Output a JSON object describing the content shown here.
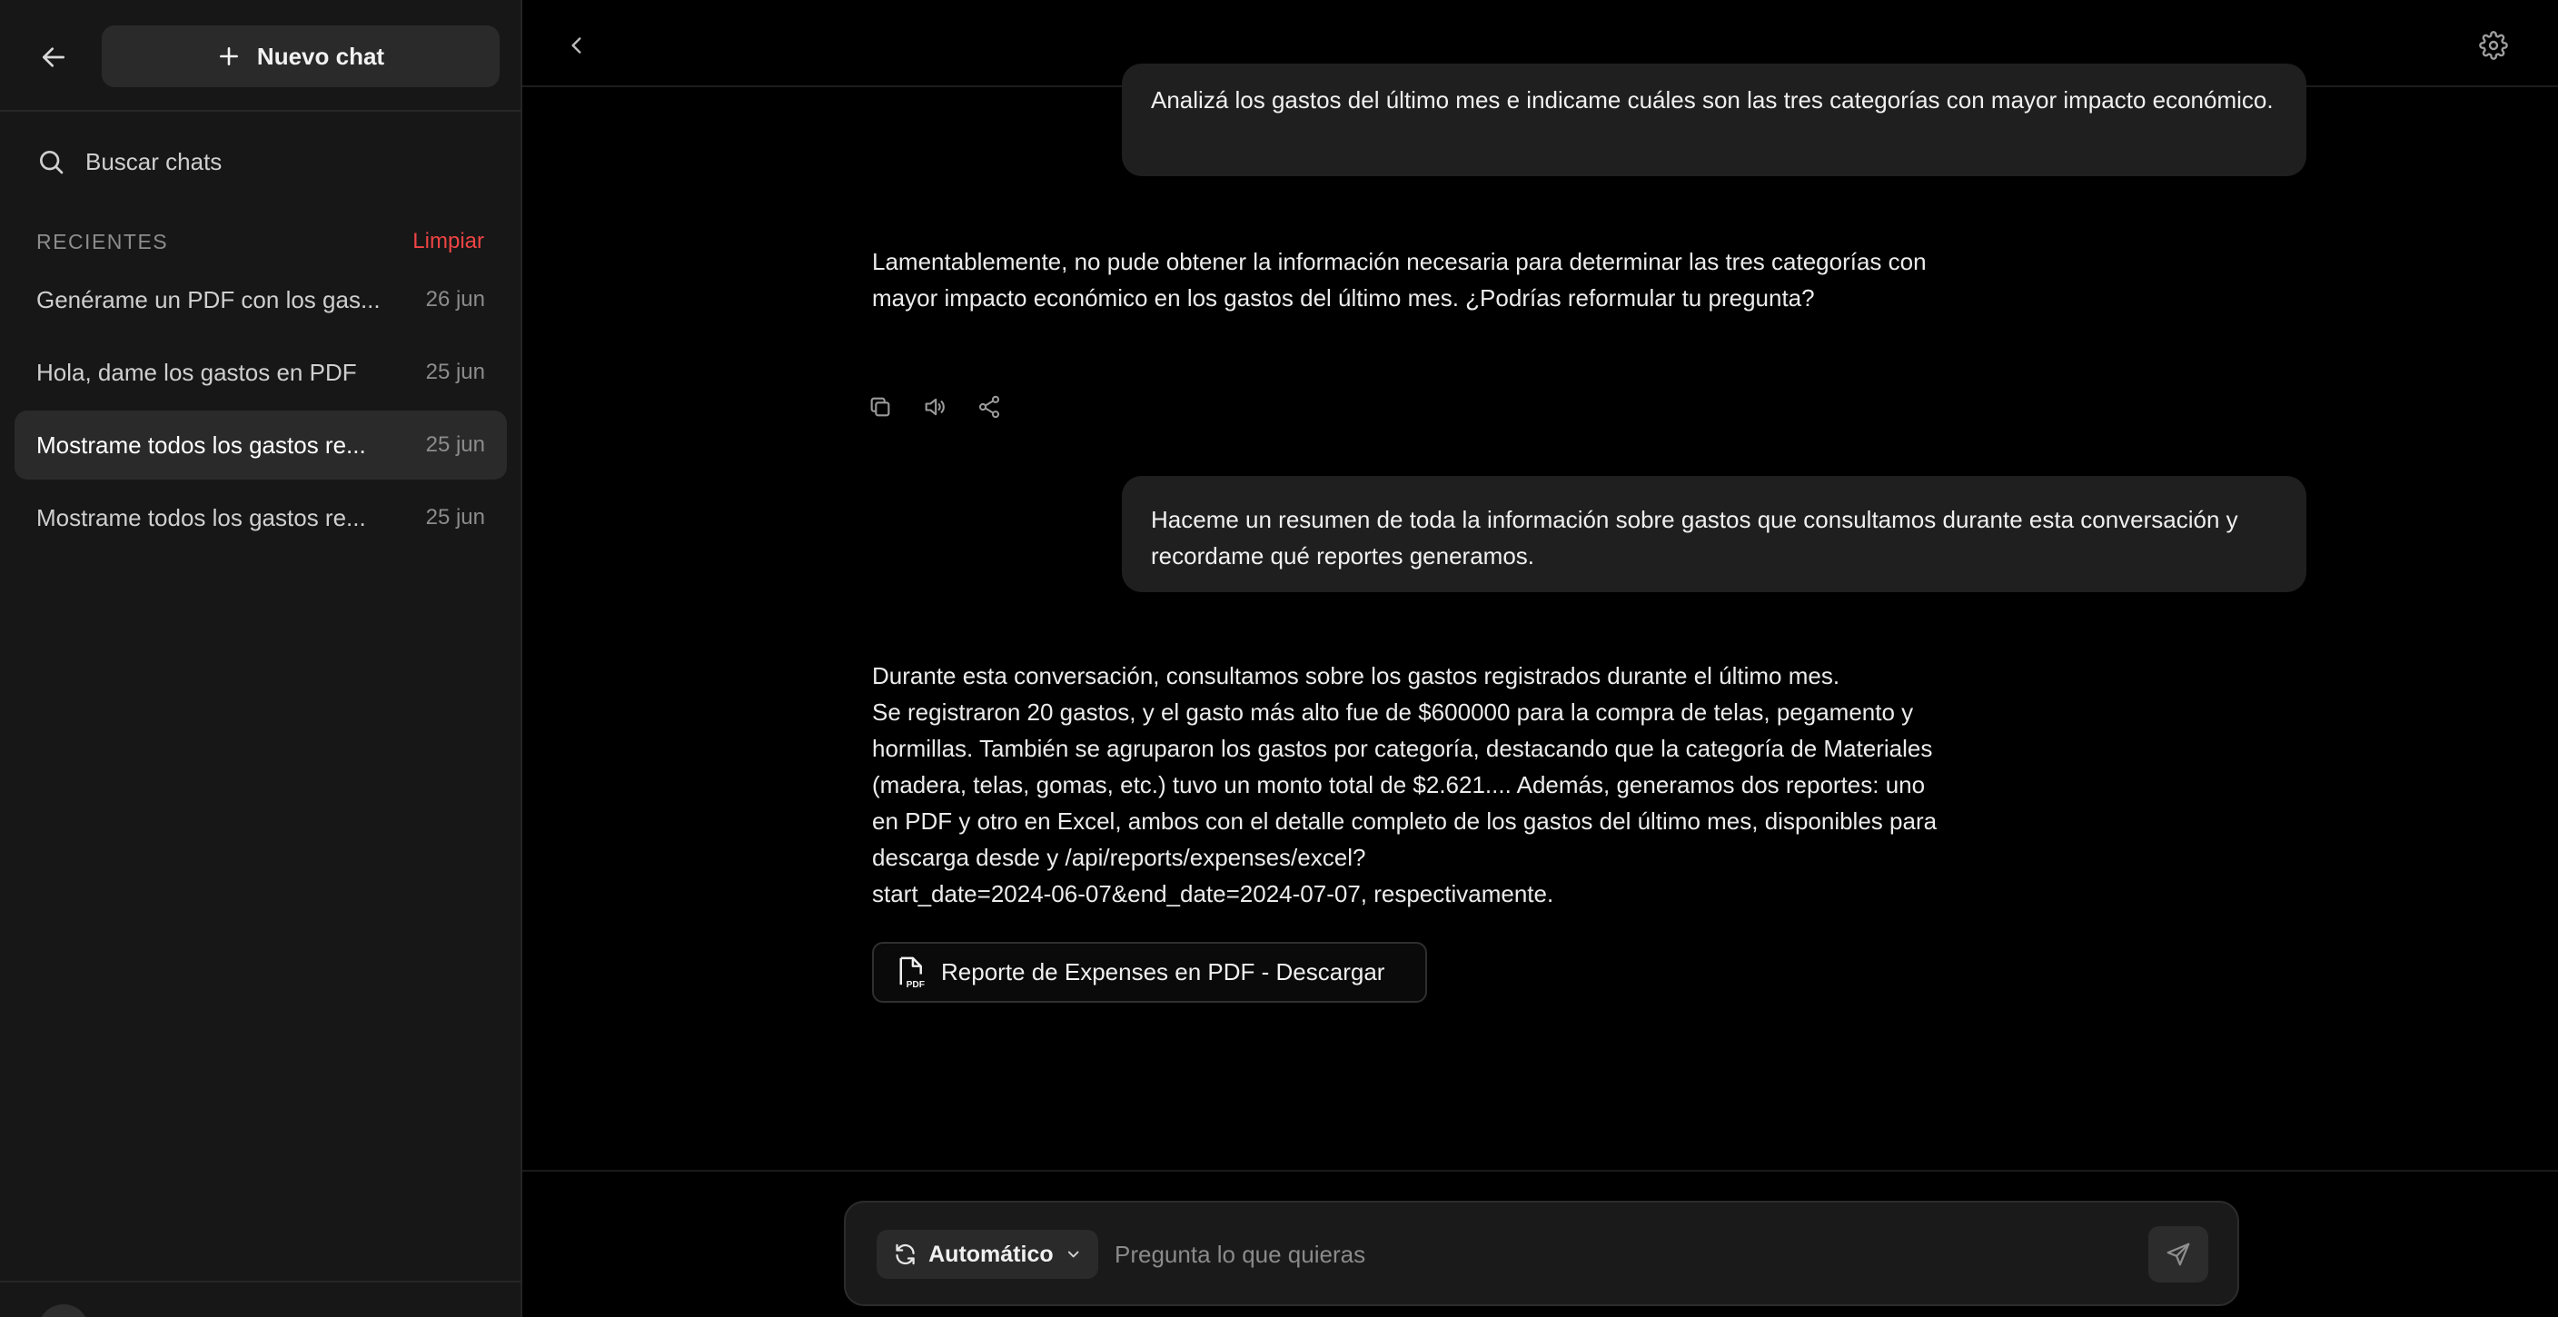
{
  "sidebar": {
    "new_chat_label": "Nuevo chat",
    "search_label": "Buscar chats",
    "recent_title": "RECIENTES",
    "clear_label": "Limpiar",
    "chats": [
      {
        "title": "Genérame un PDF con los gas...",
        "date": "26 jun",
        "active": false
      },
      {
        "title": "Hola, dame los gastos en PDF",
        "date": "25 jun",
        "active": false
      },
      {
        "title": "Mostrame todos los gastos re...",
        "date": "25 jun",
        "active": true
      },
      {
        "title": "Mostrame todos los gastos re...",
        "date": "25 jun",
        "active": false
      }
    ]
  },
  "conversation": {
    "user_msg_1": "Analizá los gastos del último mes e indicame cuáles son las tres categorías con mayor impacto económico.",
    "assistant_msg_1": "Lamentablemente, no pude obtener la información necesaria para determinar las tres categorías con mayor impacto económico en los gastos del último mes. ¿Podrías reformular tu pregunta?",
    "user_msg_2": "Haceme un resumen de toda la información sobre gastos que consultamos durante esta conversación y recordame qué reportes generamos.",
    "assistant_msg_2": "Durante esta conversación, consultamos sobre los gastos registrados durante el último mes.\nSe registraron 20 gastos, y el gasto más alto fue de $600000 para la compra de telas, pegamento y hormillas. También se agruparon los gastos por categoría, destacando que la categoría de Materiales (madera, telas, gomas, etc.) tuvo un monto total de $2.621.... Además, generamos dos reportes: uno en PDF y otro en Excel, ambos con el detalle completo de los gastos del último mes, disponibles para descarga desde y /api/reports/expenses/excel?\nstart_date=2024-06-07&end_date=2024-07-07, respectivamente.",
    "pdf_button_label": "Reporte de Expenses en PDF - Descargar"
  },
  "composer": {
    "mode_label": "Automático",
    "placeholder": "Pregunta lo que quieras"
  },
  "colors": {
    "background": "#000000",
    "sidebar": "#171717",
    "bubble": "#1f1f1f",
    "danger": "#ef4444"
  }
}
